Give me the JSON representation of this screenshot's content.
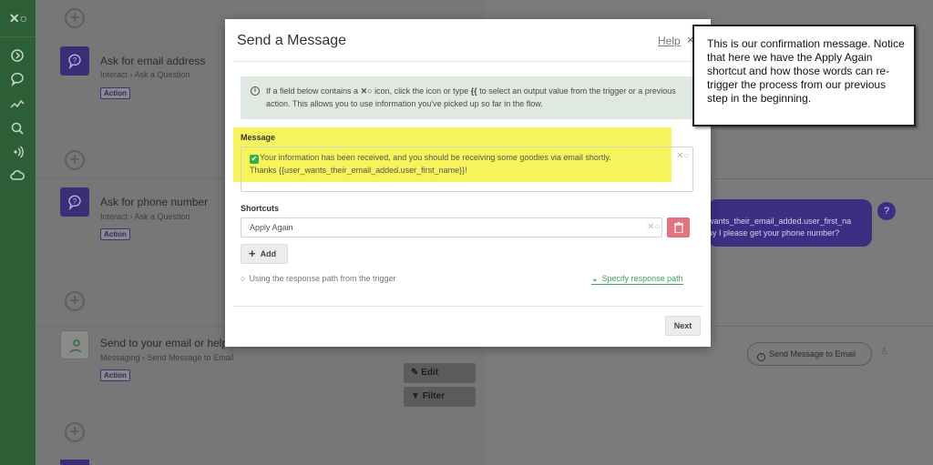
{
  "sidebar": {
    "logo_icon": "xo-logo-icon",
    "items": [
      {
        "icon": "arrow-circle-icon"
      },
      {
        "icon": "chat-bubble-icon"
      },
      {
        "icon": "activity-icon"
      },
      {
        "icon": "search-icon"
      },
      {
        "icon": "broadcast-icon"
      },
      {
        "icon": "cloud-icon"
      }
    ]
  },
  "flow": {
    "steps": [
      {
        "title": "Ask for email address",
        "path": "Interact › Ask a Question",
        "badge": "Action"
      },
      {
        "title": "Ask for phone number",
        "path": "Interact › Ask a Question",
        "badge": "Action"
      },
      {
        "title": "Send to your email or help",
        "path": "Messaging › Send Message to Email",
        "badge": "Action",
        "ellipsis": "..."
      }
    ],
    "edit_label": "Edit",
    "filter_label": "Filter",
    "preview_line1": "wants_their_email_added.user_first_na",
    "preview_line2": "ay I please get your phone number?",
    "pill_label": "Send Message to Email"
  },
  "modal": {
    "title": "Send a Message",
    "help": "Help",
    "close": "×",
    "info_text_a": "If a field below contains a",
    "info_text_b": "icon, click the icon or type",
    "info_token": "{{",
    "info_text_c": "to select an output value from the trigger or a previous action. This allows you to use information you've picked up so far in the flow.",
    "message_label": "Message",
    "message_line1": "Your information has been received, and you should be receiving some goodies via email shortly.",
    "message_line2": "Thanks {{user_wants_their_email_added.user_first_name}}!",
    "shortcuts_label": "Shortcuts",
    "shortcut_value": "Apply Again",
    "add_label": "Add",
    "response_note": "Using the response path from the trigger",
    "specify_link": "Specify response path",
    "next_label": "Next"
  },
  "callout": {
    "text": "This is our confirmation message. Notice that here we have the Apply Again shortcut and how those words can re-trigger the process from our previous step in the beginning."
  },
  "colors": {
    "sidebar": "#2d5f36",
    "accent_purple": "#3b2e83",
    "highlight": "#f6f45a",
    "link_green": "#3aa55a",
    "danger": "#e5737f"
  }
}
